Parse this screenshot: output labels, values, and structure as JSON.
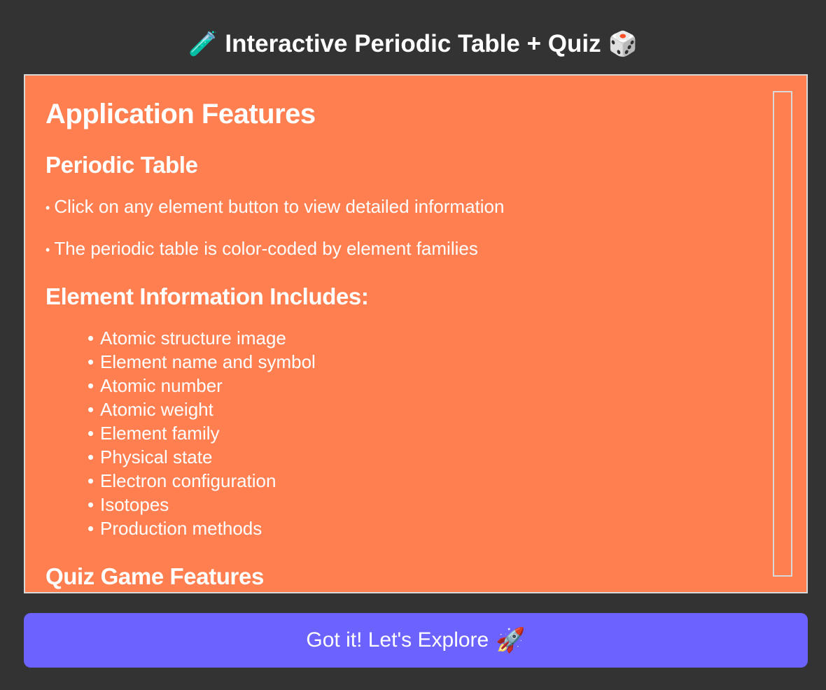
{
  "window": {
    "title": "Interactive Periodic Table + Quiz",
    "title_icon_left": "🧪",
    "title_icon_right": "🎲"
  },
  "panel": {
    "background_color": "#ff7f50",
    "heading": "Application Features",
    "sections": {
      "periodic_table": {
        "heading": "Periodic Table",
        "items": [
          "Click on any element button to view detailed information",
          "The periodic table is color-coded by element families"
        ]
      },
      "element_info": {
        "heading": "Element Information Includes:",
        "items": [
          "Atomic structure image",
          "Element name and symbol",
          "Atomic number",
          "Atomic weight",
          "Element family",
          "Physical state",
          "Electron configuration",
          "Isotopes",
          "Production methods"
        ]
      },
      "quiz": {
        "heading": "Quiz Game Features"
      }
    }
  },
  "cta": {
    "label": "Got it! Let's Explore",
    "icon": "🚀",
    "color": "#6c63ff"
  }
}
